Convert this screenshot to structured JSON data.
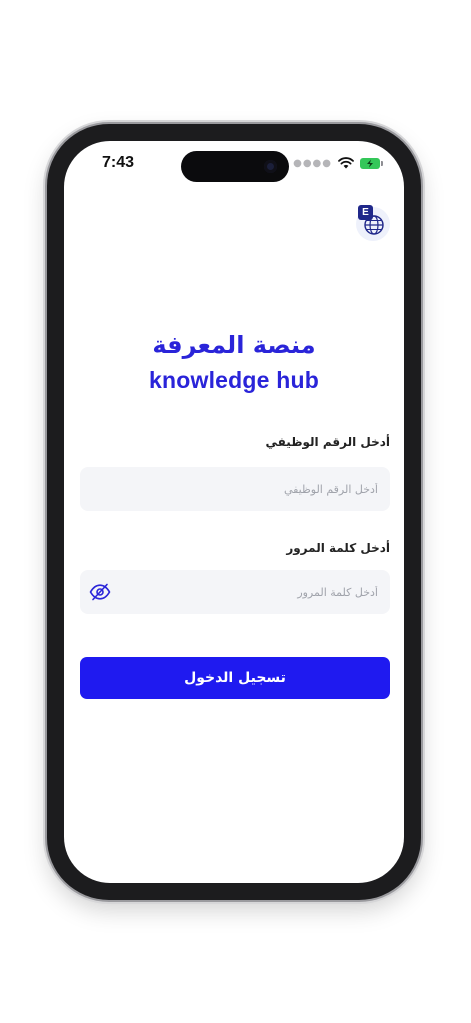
{
  "status_bar": {
    "time": "7:43",
    "signal_icon": "signal-dots-icon",
    "wifi_icon": "wifi-icon",
    "battery_icon": "battery-charging-icon",
    "battery_color": "#34c759"
  },
  "language_button": {
    "badge": "E",
    "icon": "globe-icon"
  },
  "header": {
    "title_ar": "منصة المعرفة",
    "title_en": "knowledge hub",
    "accent_color": "#2a24d9"
  },
  "form": {
    "employee_id": {
      "label": "أدخل الرقم الوظيفي",
      "placeholder": "أدخل الرقم الوظيفي",
      "value": ""
    },
    "password": {
      "label": "أدخل كلمة المرور",
      "placeholder": "أدخل كلمة المرور",
      "value": "",
      "toggle_icon": "eye-off-icon"
    },
    "submit_label": "تسجيل الدخول",
    "submit_color": "#1f1af0"
  }
}
